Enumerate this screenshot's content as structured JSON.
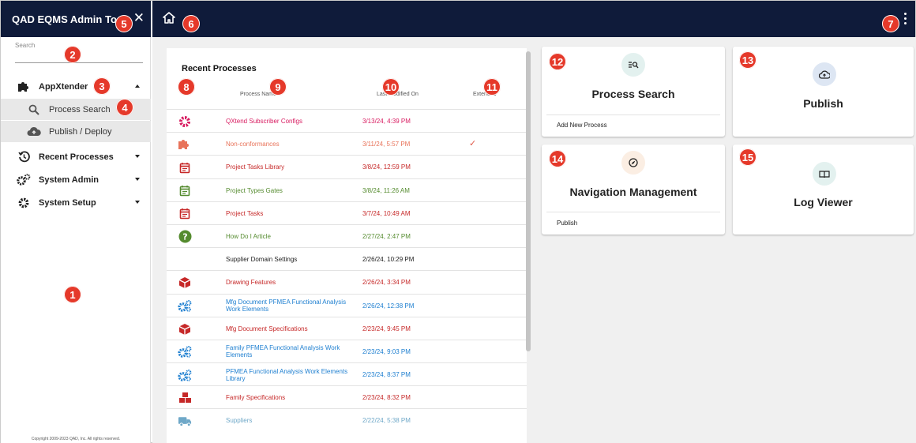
{
  "app": {
    "title": "QAD EQMS Admin Tools",
    "close_icon": "close-icon",
    "home_icon": "home-icon",
    "menu_icon": "more-vert-icon"
  },
  "sidebar": {
    "search_label": "Search",
    "groups": [
      {
        "label": "AppXtender",
        "icon": "puzzle-icon",
        "expanded": true
      },
      {
        "label": "Recent Processes",
        "icon": "history-icon",
        "expanded": false
      },
      {
        "label": "System Admin",
        "icon": "gears-icon",
        "expanded": false
      },
      {
        "label": "System Setup",
        "icon": "gear-icon",
        "expanded": false
      }
    ],
    "subitems": [
      {
        "label": "Process Search",
        "icon": "search-icon"
      },
      {
        "label": "Publish / Deploy",
        "icon": "cloud-upload-icon"
      }
    ],
    "copyright": "Copyright 2009-2023 QAD, Inc. All rights reserved."
  },
  "recent": {
    "title": "Recent Processes",
    "columns": {
      "name": "Process Name",
      "date": "Last Modified On",
      "extended": "Extended"
    },
    "rows": [
      {
        "name": "QXtend Subscriber Configs",
        "date": "3/13/24, 4:39 PM",
        "icon": "gear-icon",
        "color": "#d81b60",
        "extended": false
      },
      {
        "name": "Non-conformances",
        "date": "3/11/24, 5:57 PM",
        "icon": "puzzle-icon",
        "color": "#e8735a",
        "extended": true
      },
      {
        "name": "Project Tasks Library",
        "date": "3/8/24, 12:59 PM",
        "icon": "calendar-icon",
        "color": "#c62828",
        "extended": false
      },
      {
        "name": "Project Types Gates",
        "date": "3/8/24, 11:26 AM",
        "icon": "calendar-icon",
        "color": "#558b2f",
        "extended": false
      },
      {
        "name": "Project Tasks",
        "date": "3/7/24, 10:49 AM",
        "icon": "calendar-icon",
        "color": "#c62828",
        "extended": false
      },
      {
        "name": "How Do I Article",
        "date": "2/27/24, 2:47 PM",
        "icon": "question-icon",
        "color": "#558b2f",
        "extended": false
      },
      {
        "name": "Supplier Domain Settings",
        "date": "2/26/24, 10:29 PM",
        "icon": "",
        "color": "#222222",
        "extended": false
      },
      {
        "name": "Drawing Features",
        "date": "2/26/24, 3:34 PM",
        "icon": "cube-icon",
        "color": "#c62828",
        "extended": false
      },
      {
        "name": "Mfg Document PFMEA Functional Analysis Work Elements",
        "date": "2/26/24, 12:38 PM",
        "icon": "gears-icon",
        "color": "#1e7fd0",
        "extended": false
      },
      {
        "name": "Mfg Document Specifications",
        "date": "2/23/24, 9:45 PM",
        "icon": "cube-icon",
        "color": "#c62828",
        "extended": false
      },
      {
        "name": "Family PFMEA Functional Analysis Work Elements",
        "date": "2/23/24, 9:03 PM",
        "icon": "gears-icon",
        "color": "#1e7fd0",
        "extended": false
      },
      {
        "name": "PFMEA Functional Analysis Work Elements Library",
        "date": "2/23/24, 8:37 PM",
        "icon": "gears-icon",
        "color": "#1e7fd0",
        "extended": false
      },
      {
        "name": "Family Specifications",
        "date": "2/23/24, 8:32 PM",
        "icon": "cubes-icon",
        "color": "#c62828",
        "extended": false
      },
      {
        "name": "Suppliers",
        "date": "2/22/24, 5:38 PM",
        "icon": "truck-icon",
        "color": "#6fa8c8",
        "extended": false
      }
    ]
  },
  "cards": [
    {
      "title": "Process Search",
      "icon": "list-search-icon",
      "link": "Add New Process"
    },
    {
      "title": "Publish",
      "icon": "cloud-upload-icon",
      "link": ""
    },
    {
      "title": "Navigation Management",
      "icon": "compass-icon",
      "link": "Publish"
    },
    {
      "title": "Log Viewer",
      "icon": "book-icon",
      "link": ""
    }
  ],
  "markers": [
    "1",
    "2",
    "3",
    "4",
    "5",
    "6",
    "7",
    "8",
    "9",
    "10",
    "11",
    "12",
    "13",
    "14",
    "15"
  ],
  "colors": {
    "topbar": "#0f1b3a",
    "marker": "#e5392a"
  }
}
